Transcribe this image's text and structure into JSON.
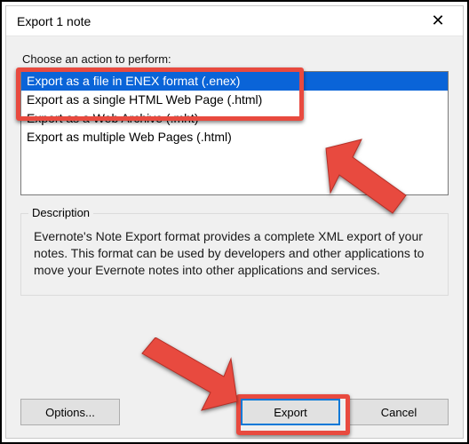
{
  "window": {
    "title": "Export 1 note"
  },
  "section": {
    "prompt": "Choose an action to perform:",
    "options": [
      "Export as a file in ENEX format (.enex)",
      "Export as a single HTML Web Page (.html)",
      "Export as a Web Archive (.mht)",
      "Export as multiple Web Pages (.html)"
    ],
    "selected_index": 0
  },
  "description": {
    "label": "Description",
    "text": "Evernote's Note Export format provides a complete XML export of your notes. This format can be used by developers and other applications to move your Evernote notes into other applications and services."
  },
  "buttons": {
    "options": "Options...",
    "export": "Export",
    "cancel": "Cancel"
  },
  "icons": {
    "close": "✕"
  }
}
